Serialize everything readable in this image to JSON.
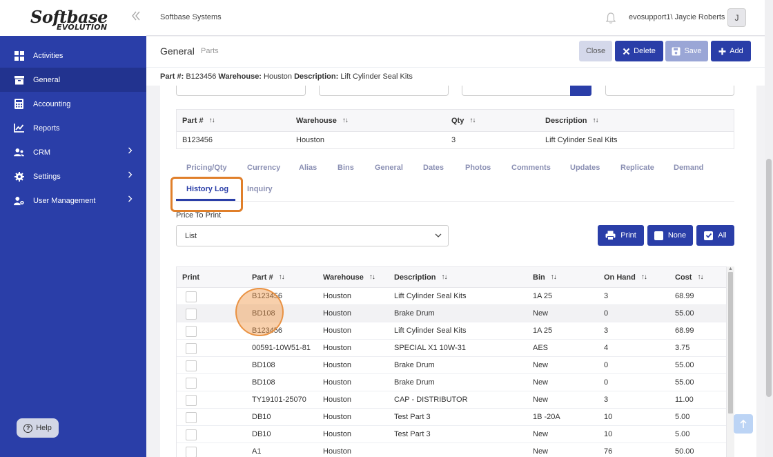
{
  "app": {
    "logo_main": "Softbase",
    "logo_sub": "EVOLUTION",
    "company": "Softbase Systems",
    "user": "evosupport1\\ Jaycie Roberts",
    "avatar_initial": "J"
  },
  "sidebar": {
    "items": [
      {
        "label": "Activities",
        "icon": "grid-icon",
        "chevron": false,
        "active": false
      },
      {
        "label": "General",
        "icon": "box-icon",
        "chevron": false,
        "active": true
      },
      {
        "label": "Accounting",
        "icon": "calculator-icon",
        "chevron": false,
        "active": false
      },
      {
        "label": "Reports",
        "icon": "chart-icon",
        "chevron": false,
        "active": false
      },
      {
        "label": "CRM",
        "icon": "users-icon",
        "chevron": true,
        "active": false
      },
      {
        "label": "Settings",
        "icon": "gear-icon",
        "chevron": true,
        "active": false
      },
      {
        "label": "User Management",
        "icon": "user-cog-icon",
        "chevron": true,
        "active": false
      }
    ],
    "help_label": "Help"
  },
  "header": {
    "title": "General",
    "breadcrumb": "Parts",
    "close_label": "Close",
    "delete_label": "Delete",
    "save_label": "Save",
    "add_label": "Add"
  },
  "infobar": {
    "part_label": "Part #:",
    "part_value": "B123456",
    "warehouse_label": "Warehouse:",
    "warehouse_value": "Houston",
    "description_label": "Description:",
    "description_value": "Lift Cylinder Seal Kits"
  },
  "summary_table": {
    "headers": [
      "Part #",
      "Warehouse",
      "Qty",
      "Description"
    ],
    "rows": [
      [
        "B123456",
        "Houston",
        "3",
        "Lift Cylinder Seal Kits"
      ]
    ]
  },
  "tabs": [
    "Pricing/Qty",
    "Currency",
    "Alias",
    "Bins",
    "General",
    "Dates",
    "Photos",
    "Comments",
    "Updates",
    "Replicate",
    "Demand"
  ],
  "tabs_row2": {
    "active": "History Log",
    "other": "Inquiry"
  },
  "price_to_print": {
    "label": "Price To Print",
    "value": "List"
  },
  "actions": {
    "print_label": "Print",
    "none_label": "None",
    "all_label": "All"
  },
  "history_table": {
    "headers": [
      "Print",
      "Part #",
      "Warehouse",
      "Description",
      "Bin",
      "On Hand",
      "Cost"
    ],
    "rows": [
      [
        "",
        "B123456",
        "Houston",
        "Lift Cylinder Seal Kits",
        "1A 25",
        "3",
        "68.99"
      ],
      [
        "",
        "BD108",
        "Houston",
        "Brake Drum",
        "New",
        "0",
        "55.00"
      ],
      [
        "",
        "B123456",
        "Houston",
        "Lift Cylinder Seal Kits",
        "1A 25",
        "3",
        "68.99"
      ],
      [
        "",
        "00591-10W51-81",
        "Houston",
        "SPECIAL X1 10W-31",
        "AES",
        "4",
        "3.75"
      ],
      [
        "",
        "BD108",
        "Houston",
        "Brake Drum",
        "New",
        "0",
        "55.00"
      ],
      [
        "",
        "BD108",
        "Houston",
        "Brake Drum",
        "New",
        "0",
        "55.00"
      ],
      [
        "",
        "TY19101-25070",
        "Houston",
        "CAP - DISTRIBUTOR",
        "New",
        "3",
        "11.00"
      ],
      [
        "",
        "DB10",
        "Houston",
        "Test Part 3",
        "1B -20A",
        "10",
        "5.00"
      ],
      [
        "",
        "DB10",
        "Houston",
        "Test Part 3",
        "New",
        "10",
        "5.00"
      ],
      [
        "",
        "A1",
        "Houston",
        "",
        "New",
        "76",
        "50.00"
      ]
    ]
  },
  "colors": {
    "primary": "#2a3ea8",
    "highlight": "#e07f2a"
  }
}
